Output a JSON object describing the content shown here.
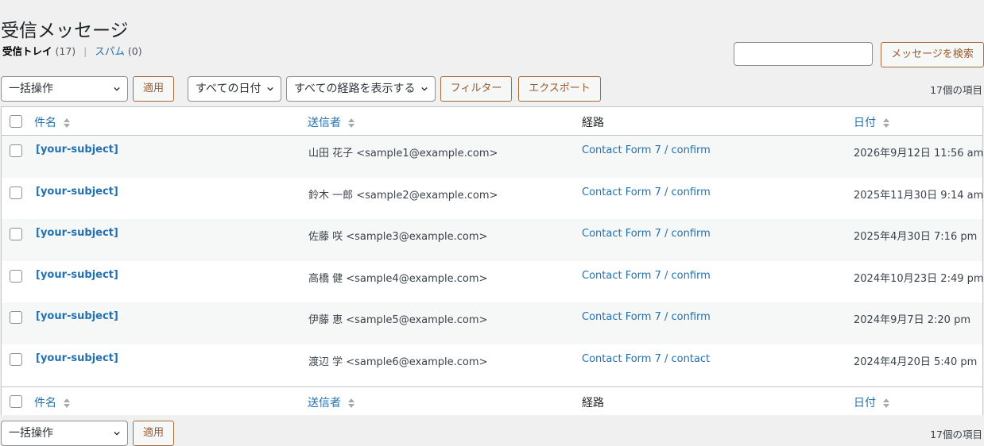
{
  "page": {
    "title": "受信メッセージ"
  },
  "views": {
    "inbox_label": "受信トレイ",
    "inbox_count": "(17)",
    "separator": "|",
    "spam_label": "スパム",
    "spam_count": "(0)"
  },
  "search": {
    "value": "",
    "button_label": "メッセージを検索"
  },
  "top_nav": {
    "bulk_action": "一括操作",
    "apply_label": "適用",
    "date_filter": "すべての日付",
    "channel_filter": "すべての経路を表示する",
    "filter_label": "フィルター",
    "export_label": "エクスポート",
    "items_count": "17個の項目"
  },
  "columns": {
    "subject": "件名",
    "sender": "送信者",
    "channel": "経路",
    "date": "日付"
  },
  "rows": [
    {
      "subject": "[your-subject]",
      "sender": "山田 花子 <sample1@example.com>",
      "channel": "Contact Form 7 / confirm",
      "date": "2026年9月12日 11:56 am"
    },
    {
      "subject": "[your-subject]",
      "sender": "鈴木 一郎 <sample2@example.com>",
      "channel": "Contact Form 7 / confirm",
      "date": "2025年11月30日 9:14 am"
    },
    {
      "subject": "[your-subject]",
      "sender": "佐藤 咲 <sample3@example.com>",
      "channel": "Contact Form 7 / confirm",
      "date": "2025年4月30日 7:16 pm"
    },
    {
      "subject": "[your-subject]",
      "sender": "高橋 健 <sample4@example.com>",
      "channel": "Contact Form 7 / confirm",
      "date": "2024年10月23日 2:49 pm"
    },
    {
      "subject": "[your-subject]",
      "sender": "伊藤 恵 <sample5@example.com>",
      "channel": "Contact Form 7 / confirm",
      "date": "2024年9月7日 2:20 pm"
    },
    {
      "subject": "[your-subject]",
      "sender": "渡辺 学 <sample6@example.com>",
      "channel": "Contact Form 7 / contact",
      "date": "2024年4月20日 5:40 pm"
    }
  ],
  "bottom_nav": {
    "bulk_action": "一括操作",
    "apply_label": "適用",
    "items_count": "17個の項目"
  },
  "colors": {
    "link": "#2271b1",
    "button_accent": "#a86b3f",
    "row_alt": "#f6f7f7",
    "background": "#f0f0f1"
  },
  "icons": {
    "sort": "sort-arrows-icon",
    "dropdown": "chevron-down-icon"
  }
}
